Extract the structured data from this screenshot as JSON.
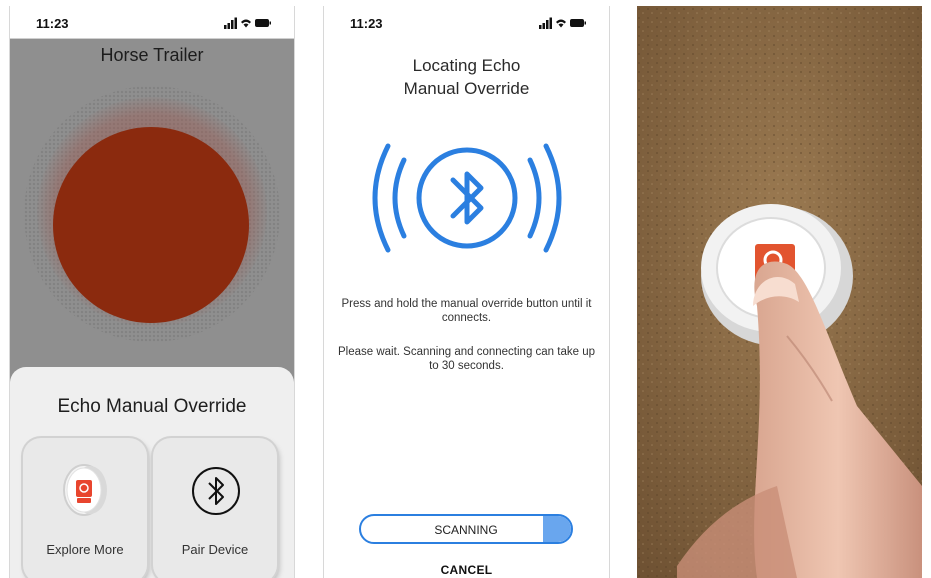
{
  "screen1": {
    "time": "11:23",
    "title": "Horse Trailer",
    "sheet_title": "Echo Manual Override",
    "tiles": [
      {
        "label": "Explore More",
        "icon": "echo-puck-icon"
      },
      {
        "label": "Pair Device",
        "icon": "bluetooth-icon"
      }
    ],
    "status_color": "#8b2a0e"
  },
  "screen2": {
    "time": "11:23",
    "title_line1": "Locating Echo",
    "title_line2": "Manual Override",
    "message1": "Press and hold the manual override button until it connects.",
    "message2": "Please wait. Scanning and connecting can take up to 30 seconds.",
    "scan_label": "SCANNING",
    "cancel_label": "CANCEL",
    "accent_color": "#2b7fe0"
  },
  "photo": {
    "icon": "finger-pressing-button-icon"
  }
}
